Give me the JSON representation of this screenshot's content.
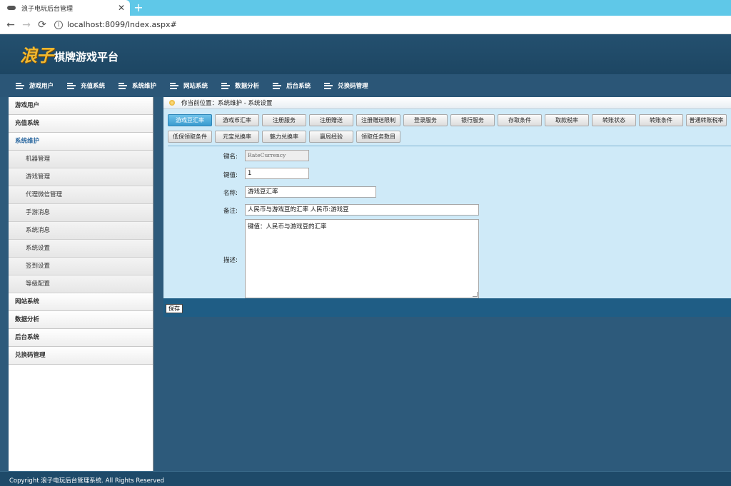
{
  "browser": {
    "tab_title": "浪子电玩后台管理",
    "tab_close": "✕",
    "new_tab": "+",
    "back": "←",
    "forward": "→",
    "reload": "⟳",
    "url": "localhost:8099/Index.aspx#"
  },
  "header": {
    "logo_mark": "浪子",
    "logo_text": "棋牌游戏平台"
  },
  "topnav": {
    "items": [
      "游戏用户",
      "充值系统",
      "系统维护",
      "网站系统",
      "数据分析",
      "后台系统",
      "兑换码管理"
    ]
  },
  "sidebar": {
    "top_items": [
      "游戏用户",
      "充值系统",
      "系统维护"
    ],
    "sub_items": [
      "机器管理",
      "游戏管理",
      "代理微信管理",
      "手游消息",
      "系统消息",
      "系统设置",
      "签到设置",
      "等级配置"
    ],
    "bottom_items": [
      "网站系统",
      "数据分析",
      "后台系统",
      "兑换码管理"
    ]
  },
  "breadcrumb": {
    "text": "你当前位置：系统维护 - 系统设置"
  },
  "buttons": {
    "row1": [
      "游戏豆汇率",
      "游戏币汇率",
      "注册服务",
      "注册赠送",
      "注册赠送限制",
      "登录服务",
      "银行服务",
      "存取条件",
      "取款税率",
      "转账状态",
      "转账条件",
      "普通转账税率"
    ],
    "row2": [
      "低保领取条件",
      "元宝兑换率",
      "魅力兑换率",
      "赢局经验",
      "领取任务数目"
    ]
  },
  "form": {
    "key_label": "键名:",
    "key_value": "RateCurrency",
    "value_label": "键值:",
    "value_value": "1",
    "name_label": "名称:",
    "name_value": "游戏豆汇率",
    "note_label": "备注:",
    "note_value": "人民币与游戏豆的汇率 人民币:游戏豆",
    "desc_label": "描述:",
    "desc_value": "键值：人民币与游戏豆的汇率"
  },
  "savebar": {
    "save_label": "保存"
  },
  "footer": {
    "text": "Copyright 浪子电玩后台管理系统. All Rights Reserved"
  }
}
